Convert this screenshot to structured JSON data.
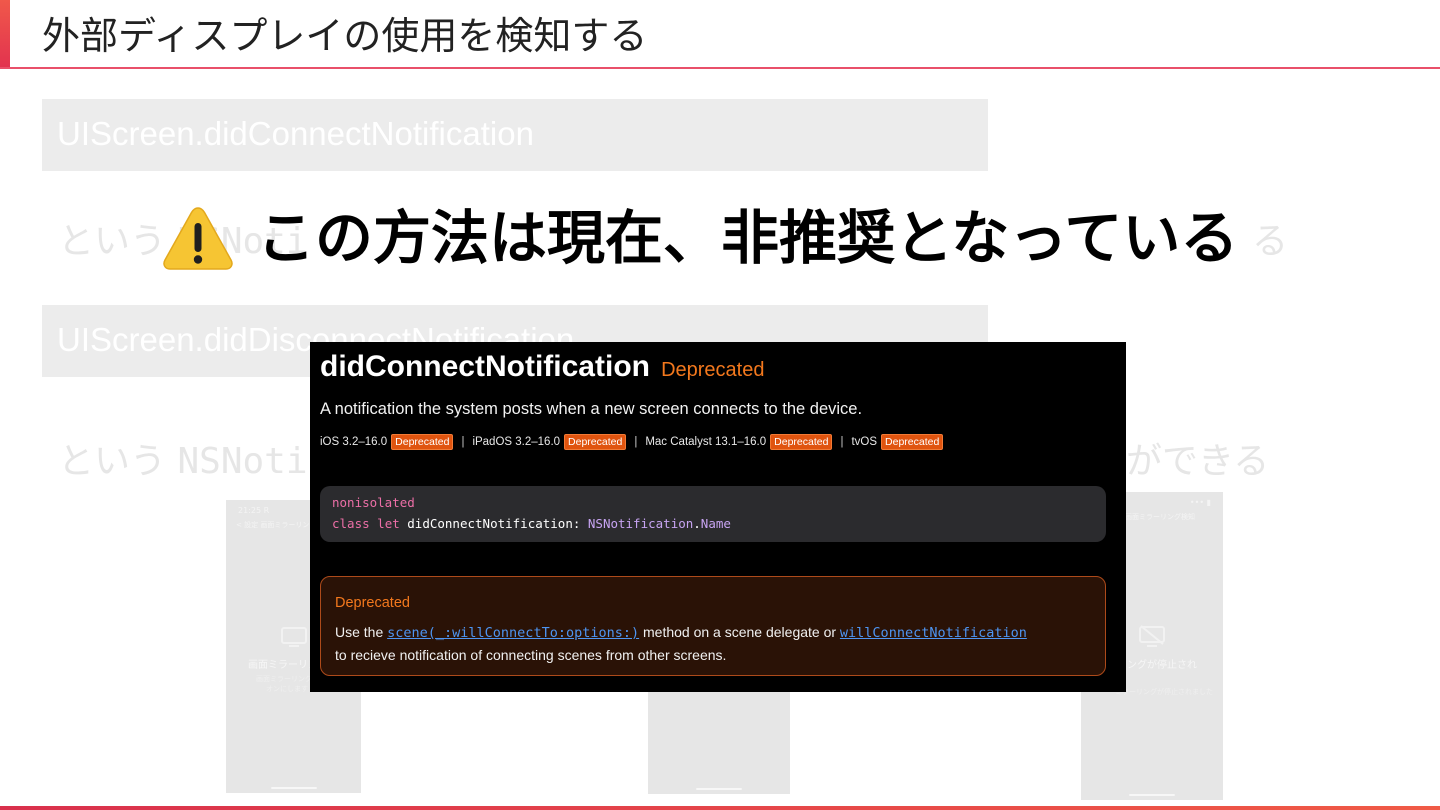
{
  "slide": {
    "title": "外部ディスプレイの使用を検知する"
  },
  "background": {
    "box1": "UIScreen.didConnectNotification",
    "line1_prefix": "という",
    "line1_code": "NSNoti",
    "line1_suffix": "る",
    "box2": "UIScreen.didDisconnectNotification",
    "line2_prefix": "という",
    "line2_code": "NSNotif",
    "line2_suffix": "ができる"
  },
  "phones": {
    "left": {
      "time": "21:25 R",
      "nav": "< 設定  画面ミラーリング",
      "label": "画面ミラーリン",
      "sub1": "画面ミラーリングを",
      "sub2": "オンにします"
    },
    "right": {
      "status": "••• ▮",
      "nav": "画面ミラーリング検知",
      "label": "リングが停止され",
      "sub1": "ミラーリングが停止されました"
    }
  },
  "warning": {
    "icon": "warning-sign-icon",
    "text": "この方法は現在、非推奨となっている"
  },
  "doc": {
    "title": "didConnectNotification",
    "title_badge": "Deprecated",
    "description": "A notification the system posts when a new screen connects to the device.",
    "availability": [
      {
        "platform": "iOS 3.2–16.0",
        "badge": "Deprecated"
      },
      {
        "platform": "iPadOS 3.2–16.0",
        "badge": "Deprecated"
      },
      {
        "platform": "Mac Catalyst 13.1–16.0",
        "badge": "Deprecated"
      },
      {
        "platform": "tvOS",
        "badge": "Deprecated"
      }
    ],
    "separator": "|",
    "code": {
      "line1": "nonisolated",
      "kw_class": "class",
      "kw_let": "let",
      "name": "didConnectNotification:",
      "type": "NSNotification",
      "dot": ".",
      "type2": "Name"
    },
    "deprecation": {
      "heading": "Deprecated",
      "text1": "Use the ",
      "link1": "scene(_:willConnectTo:options:)",
      "text2": " method on a scene delegate or ",
      "link2": "willConnectNotification",
      "text3": "to recieve notification of connecting scenes from other screens."
    }
  },
  "colors": {
    "accent": "#e9506a",
    "deprecated_orange": "#f3781d",
    "badge_bg": "#e0540f",
    "link_blue": "#4e95f2"
  }
}
